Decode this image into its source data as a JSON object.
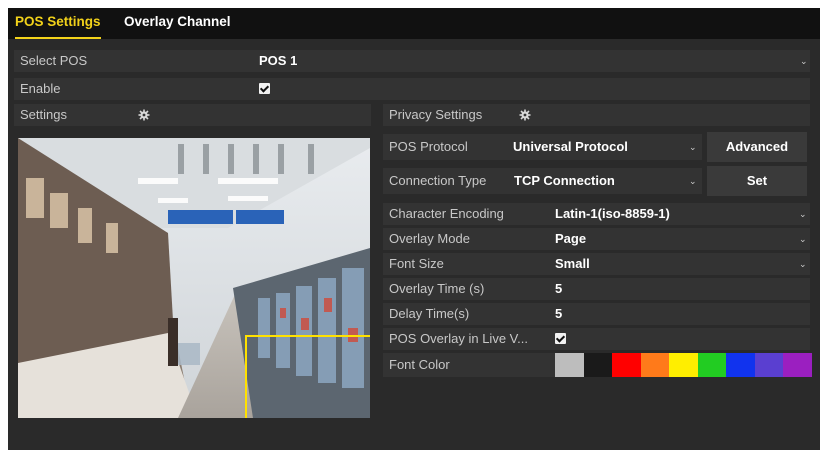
{
  "tabs": [
    {
      "label": "POS Settings",
      "active": true
    },
    {
      "label": "Overlay Channel",
      "active": false
    }
  ],
  "select_pos": {
    "label": "Select POS",
    "value": "POS 1"
  },
  "enable": {
    "label": "Enable",
    "checked": true
  },
  "settings": {
    "label": "Settings",
    "icon": "gear-icon"
  },
  "privacy": {
    "label": "Privacy Settings",
    "icon": "gear-icon"
  },
  "pos_protocol": {
    "label": "POS Protocol",
    "value": "Universal Protocol",
    "button": "Advanced"
  },
  "connection_type": {
    "label": "Connection Type",
    "value": "TCP Connection",
    "button": "Set"
  },
  "character_encoding": {
    "label": "Character Encoding",
    "value": "Latin-1(iso-8859-1)"
  },
  "overlay_mode": {
    "label": "Overlay Mode",
    "value": "Page"
  },
  "font_size": {
    "label": "Font Size",
    "value": "Small"
  },
  "overlay_time": {
    "label": "Overlay Time (s)",
    "value": "5"
  },
  "delay_time": {
    "label": "Delay Time(s)",
    "value": "5"
  },
  "pos_overlay_live": {
    "label": "POS Overlay in Live V...",
    "checked": true
  },
  "font_color": {
    "label": "Font Color",
    "swatches": [
      "#bdbdbd",
      "#1a1a1a",
      "#ff0000",
      "#ff7a1a",
      "#ffee00",
      "#22cc22",
      "#1133ee",
      "#5a3fd0",
      "#9b1fc0"
    ]
  },
  "colors": {
    "accent": "#f2d21a",
    "overlay_region": "#ffe100"
  }
}
